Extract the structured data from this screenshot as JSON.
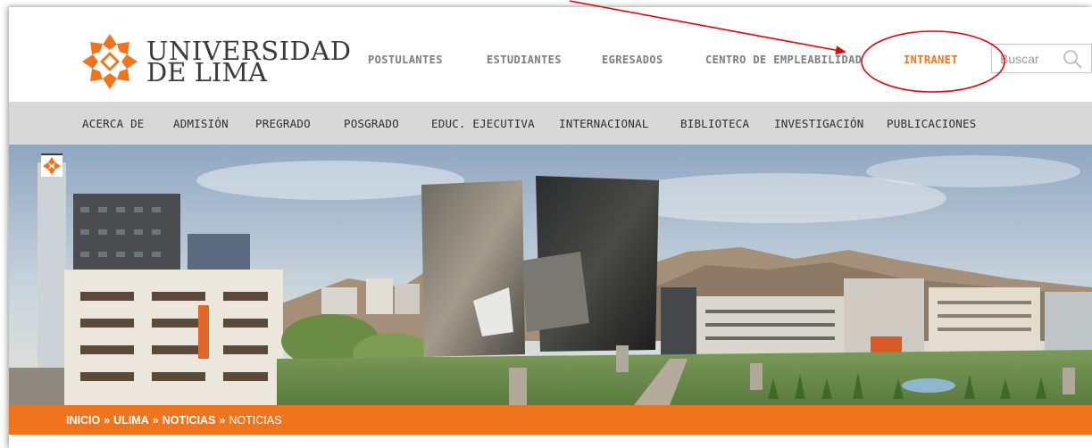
{
  "logo": {
    "line1": "UNIVERSIDAD",
    "line2": "DE LIMA",
    "icon": "ulima-star-icon"
  },
  "topnav": {
    "items": [
      {
        "label": "POSTULANTES"
      },
      {
        "label": "ESTUDIANTES"
      },
      {
        "label": "EGRESADOS"
      },
      {
        "label": "CENTRO DE EMPLEABILIDAD"
      },
      {
        "label": "INTRANET"
      }
    ]
  },
  "search": {
    "placeholder": "Buscar",
    "icon": "search-icon"
  },
  "mainnav": {
    "items": [
      {
        "label": "ACERCA DE"
      },
      {
        "label": "ADMISIÓN"
      },
      {
        "label": "PREGRADO"
      },
      {
        "label": "POSGRADO"
      },
      {
        "label": "EDUC. EJECUTIVA"
      },
      {
        "label": "INTERNACIONAL"
      },
      {
        "label": "BIBLIOTECA"
      },
      {
        "label": "INVESTIGACIÓN"
      },
      {
        "label": "PUBLICACIONES"
      }
    ]
  },
  "breadcrumb": {
    "items": [
      "INICIO",
      "ULIMA",
      "NOTICIAS"
    ],
    "separator": "»",
    "current": "NOTICIAS"
  },
  "colors": {
    "accent": "#f0741c",
    "nav_bg": "#d8d8d8",
    "annotation": "#e8000b"
  }
}
